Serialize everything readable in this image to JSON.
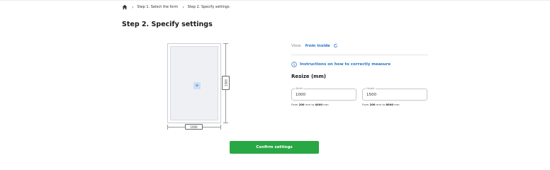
{
  "breadcrumb": {
    "home_icon": "home-icon",
    "items": [
      "Step 1. Select the form",
      "Step 2. Specify settings"
    ]
  },
  "page_title": "Step 2. Specify settings",
  "drawing": {
    "height_value": "1500",
    "width_value": "1000",
    "add_icon": "plus-icon"
  },
  "view": {
    "label": "View:",
    "value": "from inside",
    "icon": "rotate-icon"
  },
  "instructions": {
    "text": "Instructions on how to correctly measure",
    "icon": "info-icon"
  },
  "resize": {
    "title": "Resize (mm)",
    "width": {
      "label": "Width",
      "value": "1000",
      "hint_prefix": "From ",
      "min": "200",
      "hint_mid": " mm to ",
      "max": "4000",
      "hint_suffix": " mm"
    },
    "height": {
      "label": "Height",
      "value": "1500",
      "hint_prefix": "From ",
      "min": "200",
      "hint_mid": " mm to ",
      "max": "6000",
      "hint_suffix": " mm"
    }
  },
  "confirm_label": "Confirm settings",
  "colors": {
    "accent": "#2a73c9",
    "confirm": "#28a745"
  }
}
